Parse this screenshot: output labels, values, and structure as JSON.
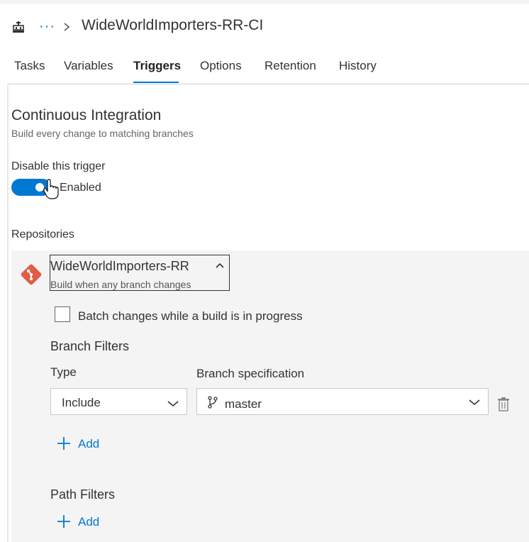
{
  "header": {
    "more_label": "···",
    "title": "WideWorldImporters-RR-CI"
  },
  "tabs": [
    {
      "label": "Tasks",
      "active": false
    },
    {
      "label": "Variables",
      "active": false
    },
    {
      "label": "Triggers",
      "active": true
    },
    {
      "label": "Options",
      "active": false
    },
    {
      "label": "Retention",
      "active": false
    },
    {
      "label": "History",
      "active": false
    }
  ],
  "ci": {
    "title": "Continuous Integration",
    "subtitle": "Build every change to matching branches",
    "disable_label": "Disable this trigger",
    "toggle_on": true,
    "toggle_state_label": "Enabled"
  },
  "repositories": {
    "label": "Repositories",
    "repo_name": "WideWorldImporters-RR",
    "repo_subtitle": "Build when any branch changes",
    "batch_label": "Batch changes while a build is in progress",
    "batch_checked": false
  },
  "branch_filters": {
    "title": "Branch Filters",
    "type_label": "Type",
    "spec_label": "Branch specification",
    "type_value": "Include",
    "spec_value": "master",
    "add_label": "Add"
  },
  "path_filters": {
    "title": "Path Filters",
    "add_label": "Add"
  },
  "colors": {
    "accent": "#0078d4",
    "git": "#e05d44"
  }
}
